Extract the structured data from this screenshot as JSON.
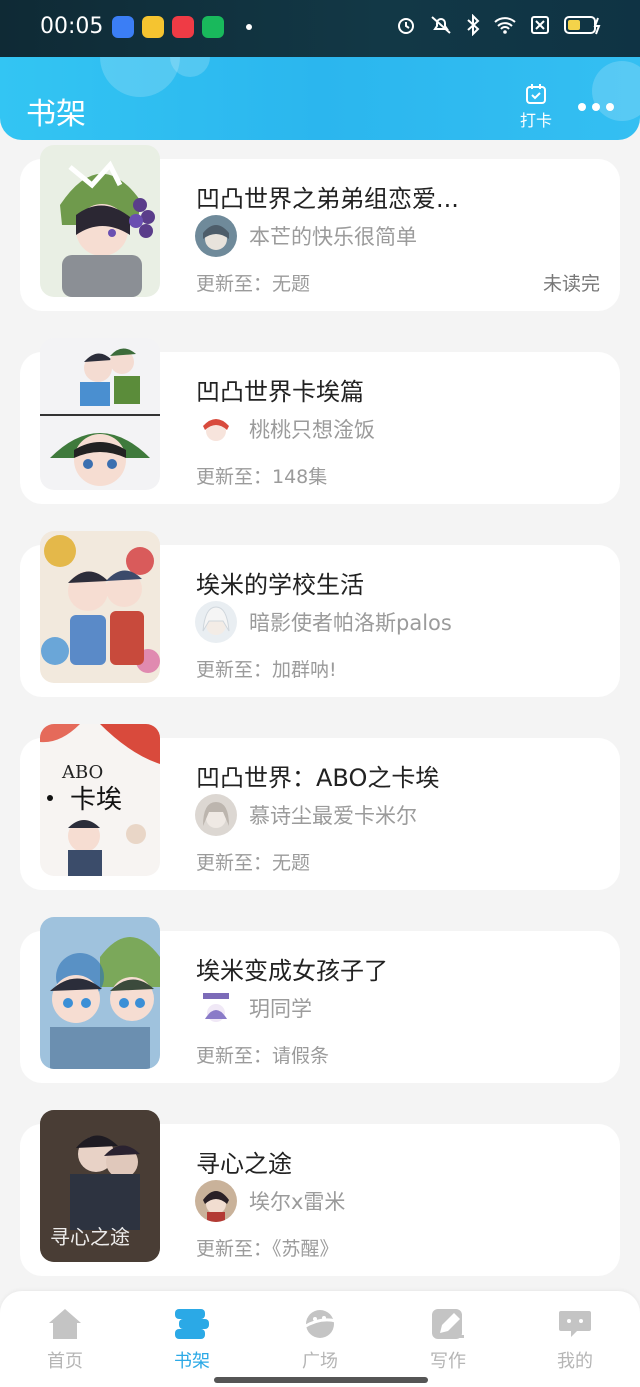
{
  "status_bar": {
    "time": "00:05"
  },
  "header": {
    "title": "书架",
    "checkin_label": "打卡"
  },
  "books": [
    {
      "title": "凹凸世界之弟弟组恋爱...",
      "author": "本芒的快乐很简单",
      "update": "更新至：无题",
      "status": "未读完"
    },
    {
      "title": "凹凸世界卡埃篇",
      "author": "桃桃只想淦饭",
      "update": "更新至：148集",
      "status": ""
    },
    {
      "title": "埃米的学校生活",
      "author": "暗影使者帕洛斯palos",
      "update": "更新至：加群呐!",
      "status": ""
    },
    {
      "title": "凹凸世界：ABO之卡埃",
      "author": "慕诗尘最爱卡米尔",
      "update": "更新至：无题",
      "status": "",
      "cover_text": [
        "ABO",
        "卡埃"
      ]
    },
    {
      "title": "埃米变成女孩子了",
      "author": "玥同学",
      "update": "更新至：请假条",
      "status": ""
    },
    {
      "title": "寻心之途",
      "author": "埃尔x雷米",
      "update": "更新至：《苏醒》",
      "status": "",
      "cover_text": [
        "寻心之途"
      ]
    }
  ],
  "nav": [
    {
      "label": "首页",
      "icon": "home-icon",
      "active": false
    },
    {
      "label": "书架",
      "icon": "bookshelf-icon",
      "active": true
    },
    {
      "label": "广场",
      "icon": "planet-icon",
      "active": false
    },
    {
      "label": "写作",
      "icon": "pen-icon",
      "active": false
    },
    {
      "label": "我的",
      "icon": "chat-bubble-icon",
      "active": false
    }
  ],
  "colors": {
    "accent": "#2ba9e6",
    "header": "#33c5f3",
    "status_bar": "#0f2a35"
  }
}
